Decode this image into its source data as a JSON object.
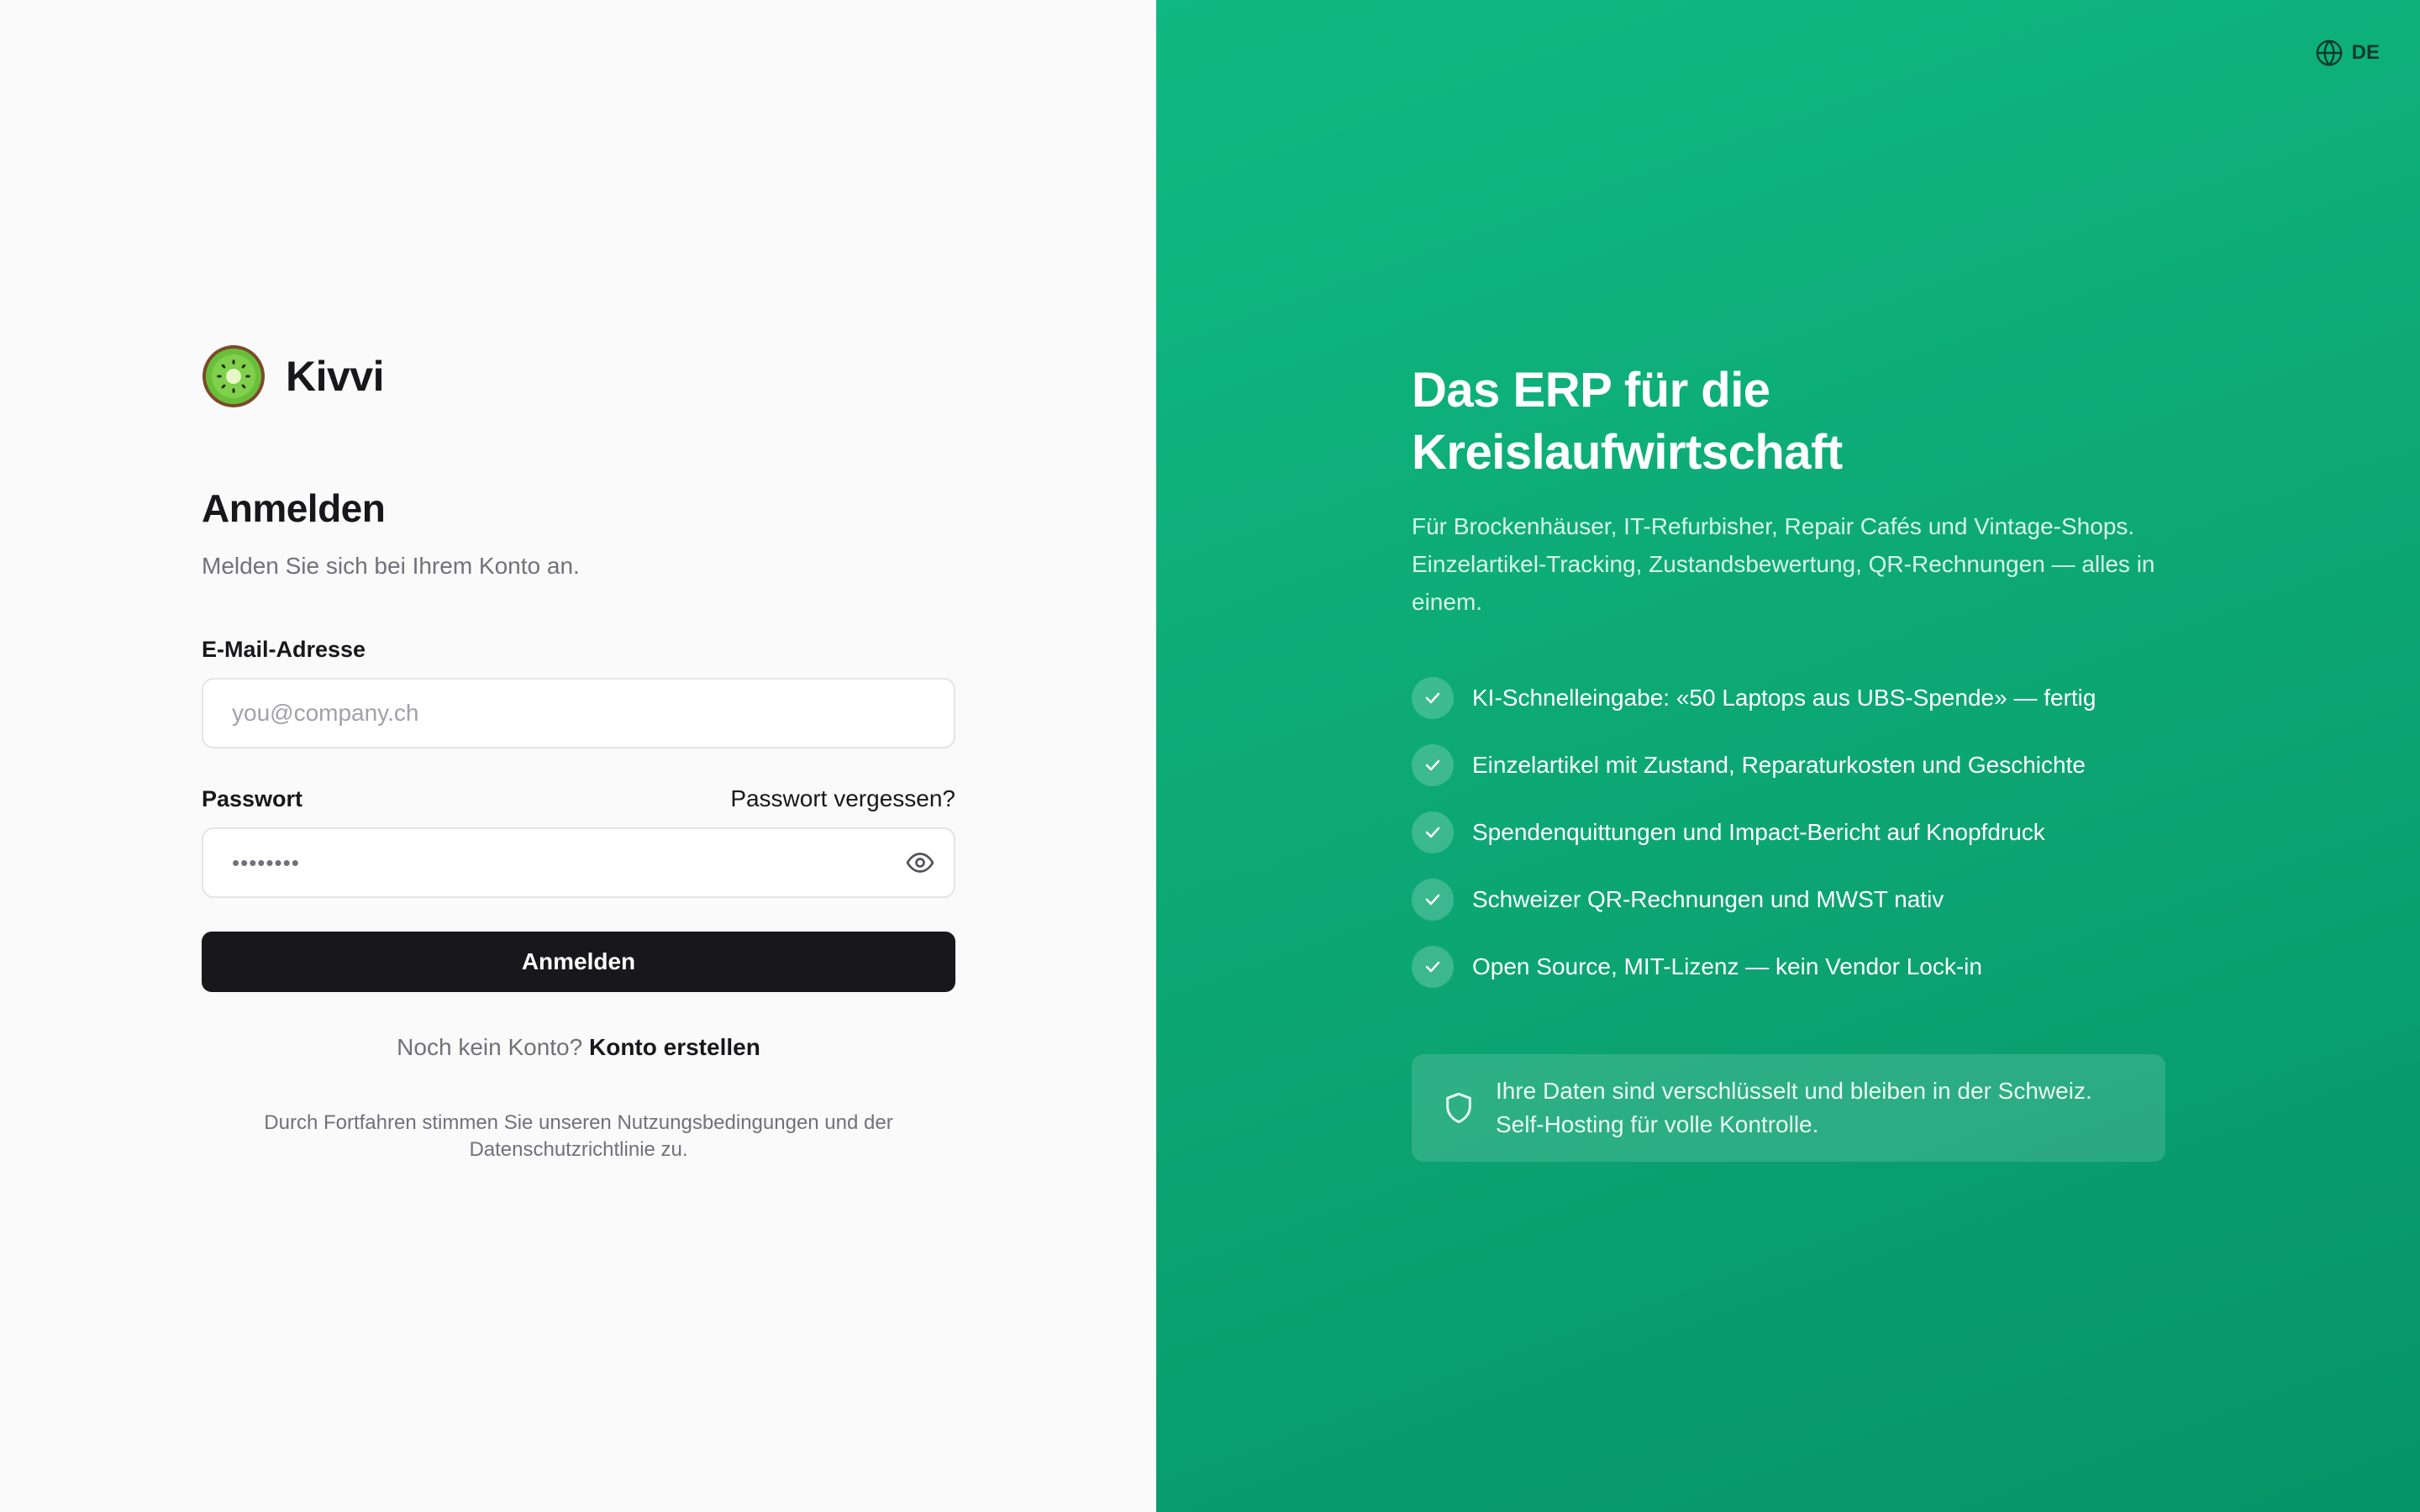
{
  "brand": {
    "name": "Kivvi",
    "logo_icon": "kiwi-logo-icon"
  },
  "login": {
    "title": "Anmelden",
    "subtitle": "Melden Sie sich bei Ihrem Konto an.",
    "email_label": "E-Mail-Adresse",
    "email_placeholder": "you@company.ch",
    "email_value": "",
    "password_label": "Passwort",
    "forgot_link": "Passwort vergessen?",
    "password_value": "••••••••",
    "submit_label": "Anmelden",
    "signup_prompt": "Noch kein Konto?",
    "signup_link": "Konto erstellen",
    "legal": "Durch Fortfahren stimmen Sie unseren Nutzungsbedingungen und der Datenschutzrichtlinie zu."
  },
  "language": {
    "current": "DE",
    "icon": "globe-icon"
  },
  "promo": {
    "headline": "Das ERP für die Kreislaufwirtschaft",
    "description": "Für Brockenhäuser, IT-Refurbisher, Repair Cafés und Vintage-Shops. Einzelartikel-Tracking, Zustandsbewertung, QR-Rechnungen — alles in einem.",
    "features": [
      "KI-Schnelleingabe: «50 Laptops aus UBS-Spende» — fertig",
      "Einzelartikel mit Zustand, Reparaturkosten und Geschichte",
      "Spendenquittungen und Impact-Bericht auf Knopfdruck",
      "Schweizer QR-Rechnungen und MWST nativ",
      "Open Source, MIT-Lizenz — kein Vendor Lock-in"
    ],
    "security_note": "Ihre Daten sind verschlüsselt und bleiben in der Schweiz. Self-Hosting für volle Kontrolle."
  },
  "colors": {
    "accent_green": "#10b981",
    "button_dark": "#18181b",
    "background_light": "#fafafa"
  }
}
